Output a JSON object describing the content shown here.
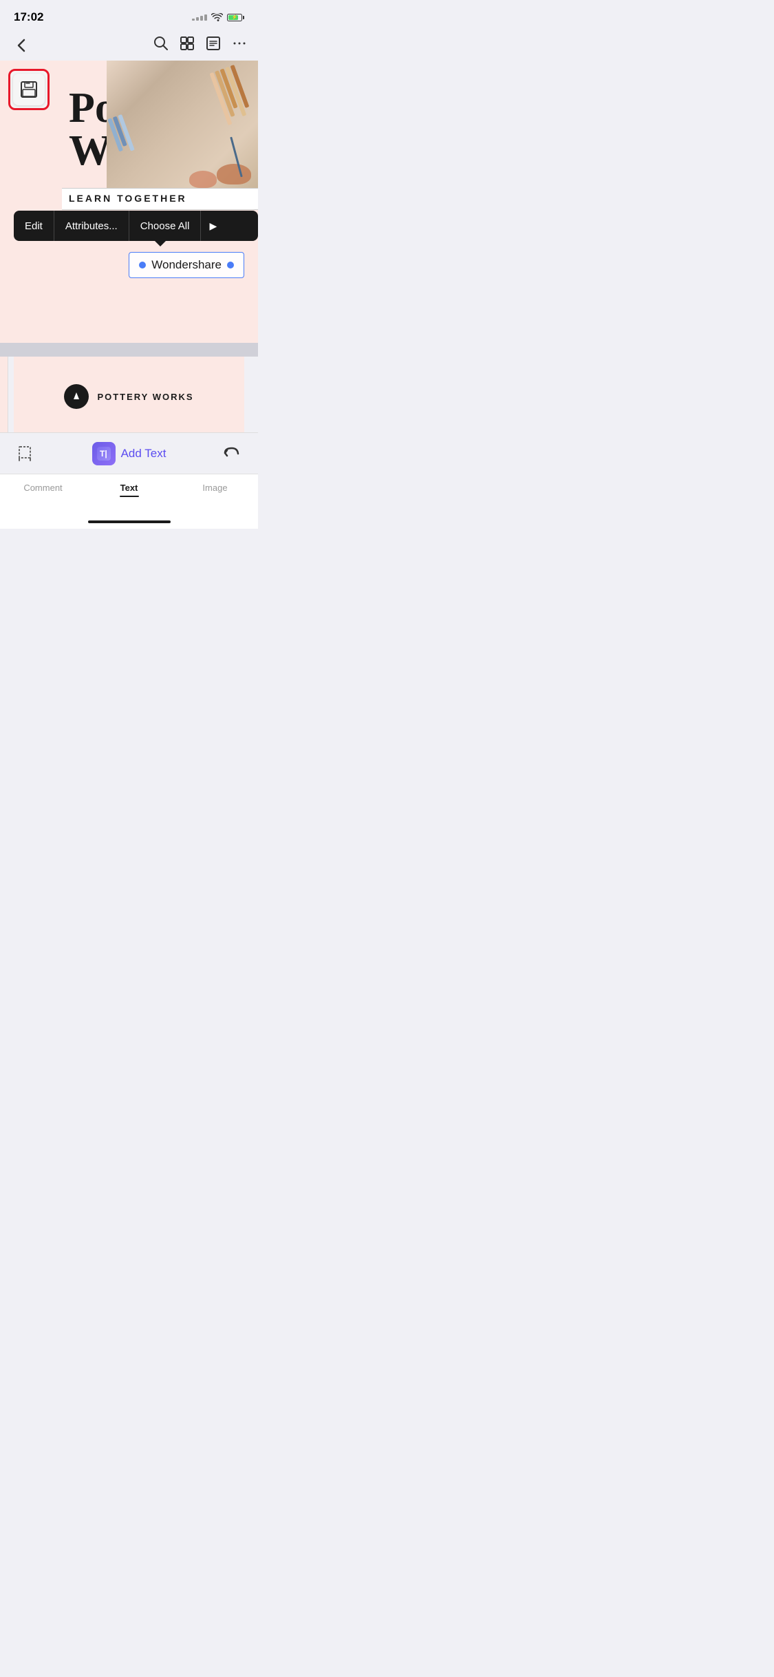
{
  "statusBar": {
    "time": "17:02"
  },
  "navBar": {
    "backLabel": "‹",
    "searchIcon": "search",
    "gridIcon": "grid",
    "listIcon": "list",
    "moreIcon": "more"
  },
  "canvas": {
    "title1": "Pottery",
    "title2": "Workshop",
    "learnTogether": "LEARN TOGETHER",
    "saveIconLabel": "save"
  },
  "contextMenu": {
    "editLabel": "Edit",
    "attributesLabel": "Attributes...",
    "chooseAllLabel": "Choose All",
    "arrowLabel": "▶"
  },
  "selectedBox": {
    "text": "Wondershare"
  },
  "secondPage": {
    "brandName": "POTTERY WORKS"
  },
  "bottomToolbar": {
    "addTextLabel": "Add Text",
    "addTextIcon": "T|",
    "cropIcon": "crop",
    "undoIcon": "↩"
  },
  "tabBar": {
    "tabs": [
      {
        "label": "Comment",
        "active": false
      },
      {
        "label": "Text",
        "active": true
      },
      {
        "label": "Image",
        "active": false
      }
    ]
  }
}
